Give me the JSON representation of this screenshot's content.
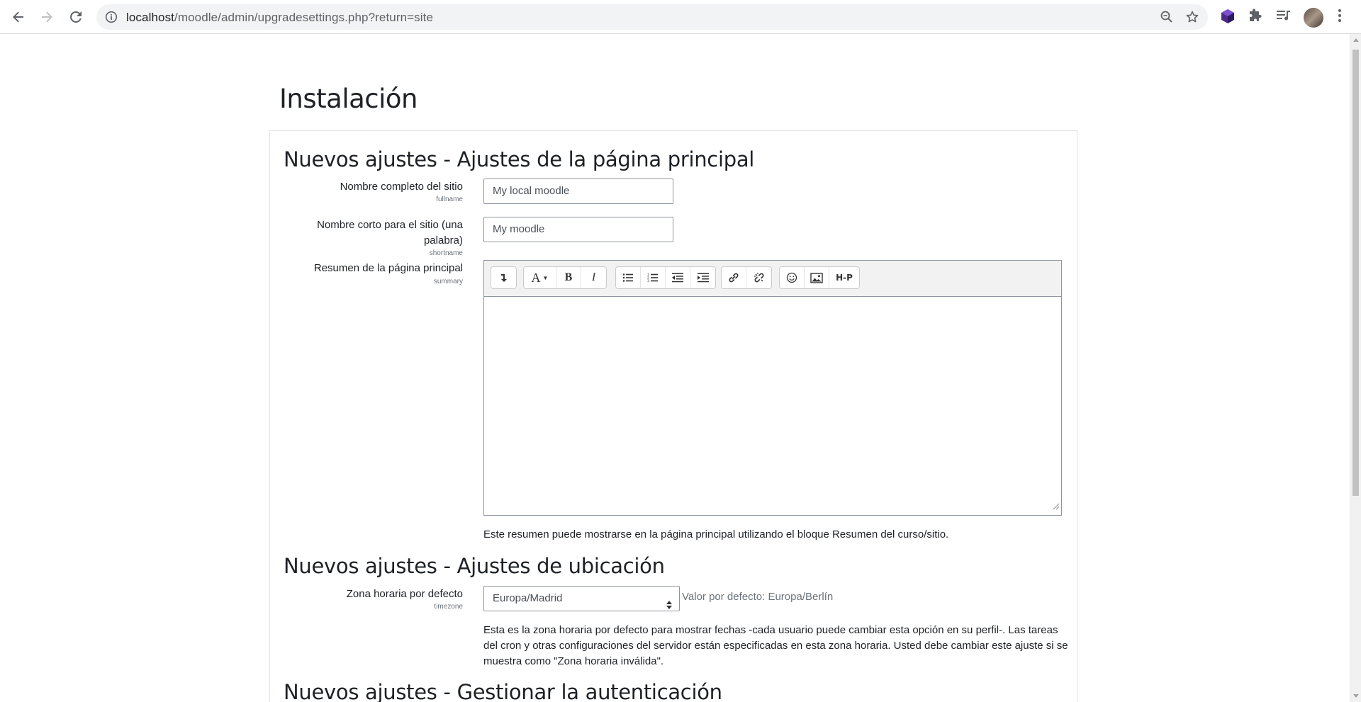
{
  "browser": {
    "url_host": "localhost",
    "url_path": "/moodle/admin/upgradesettings.php?return=site"
  },
  "page": {
    "title": "Instalación"
  },
  "sections": [
    {
      "heading": "Nuevos ajustes - Ajustes de la página principal",
      "fields": {
        "fullname": {
          "label": "Nombre completo del sitio",
          "name": "fullname",
          "value": "My local moodle"
        },
        "shortname": {
          "label_line1": "Nombre corto para el sitio (una",
          "label_line2": "palabra)",
          "name": "shortname",
          "value": "My moodle"
        },
        "summary": {
          "label": "Resumen de la página principal",
          "name": "summary",
          "value": "",
          "help": "Este resumen puede mostrarse en la página principal utilizando el bloque Resumen del curso/sitio."
        }
      }
    },
    {
      "heading": "Nuevos ajustes - Ajustes de ubicación",
      "fields": {
        "timezone": {
          "label": "Zona horaria por defecto",
          "name": "timezone",
          "value": "Europa/Madrid",
          "default_note": "Valor por defecto: Europa/Berlín",
          "help_line1": "Esta es la zona horaria por defecto para mostrar fechas -cada usuario puede cambiar esta opción en su perfil-. Las tareas",
          "help_line2": "del cron y otras configuraciones del servidor están especificadas en esta zona horaria. Usted debe cambiar este ajuste si se",
          "help_line3": "muestra como \"Zona horaria inválida\"."
        }
      }
    },
    {
      "heading": "Nuevos ajustes - Gestionar la autenticación"
    }
  ],
  "editor_toolbar": {
    "font_glyph": "A",
    "bold_glyph": "B",
    "italic_glyph": "I",
    "h5p_glyph": "H-P"
  }
}
